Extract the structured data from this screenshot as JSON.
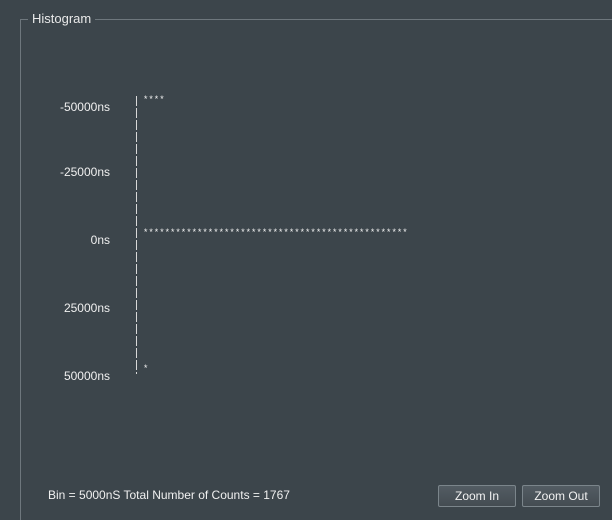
{
  "panel": {
    "title": "Histogram"
  },
  "histogram": {
    "rows": [
      {
        "label": "-50000ns",
        "bar": "****"
      },
      {
        "label": "-25000ns",
        "bar": ""
      },
      {
        "label": "0ns",
        "bar": "*************************************************"
      },
      {
        "label": "25000ns",
        "bar": ""
      },
      {
        "label": "50000ns",
        "bar": "*"
      }
    ]
  },
  "status": {
    "text": "Bin = 5000nS Total Number of Counts = 1767"
  },
  "buttons": {
    "zoom_in": "Zoom In",
    "zoom_out": "Zoom Out"
  },
  "colors": {
    "background": "#3c454b",
    "text": "#f0f0f0",
    "border": "#6e777d"
  }
}
